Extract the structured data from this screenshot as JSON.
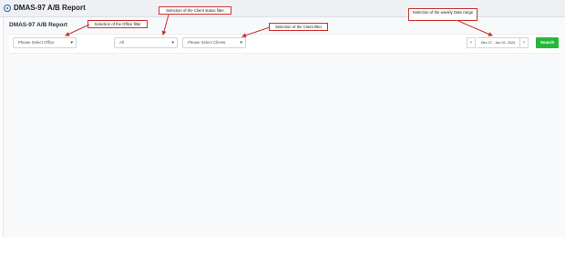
{
  "app": {
    "title": "DMAS-97 A/B Report"
  },
  "page": {
    "title": "DMAS-97 A/B Report"
  },
  "filters": {
    "office": {
      "value": "Please Select Office"
    },
    "client_status": {
      "value": "All"
    },
    "client": {
      "value": "Please Select Clients"
    },
    "date_range": {
      "value": "Dec 27 - Jan 02, 2024",
      "prev": "‹",
      "next": "›"
    },
    "search_label": "Search"
  },
  "callouts": {
    "office": "Selection of the Office filter",
    "client_status": "Selection of the Client status filter",
    "client": "Selection of the Client filter",
    "date": "Selection of the weekly Date range"
  },
  "colors": {
    "accent": "#27b63a",
    "callout_border": "#c9332b",
    "brand": "#3b5fa8"
  }
}
